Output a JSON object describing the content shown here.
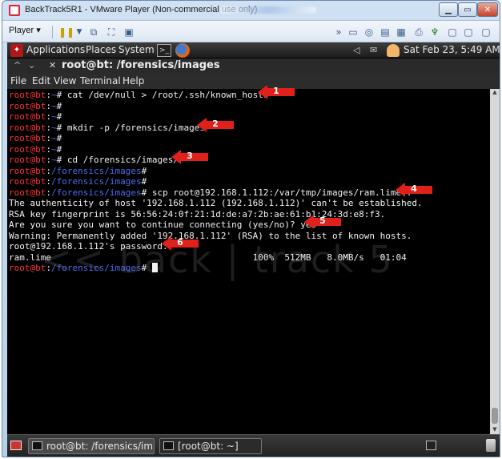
{
  "vm": {
    "title": "BackTrack5R1 - VMware Player (Non-commercial use only)",
    "player_label": "Player ▾",
    "minimize": "▁",
    "maximize": "▭",
    "close": "✕"
  },
  "gnome_panel": {
    "applications": "Applications",
    "places": "Places",
    "system": "System",
    "datetime": "Sat Feb 23,  5:49 AM"
  },
  "terminal": {
    "title": "root@bt: /forensics/images",
    "menu": [
      "File",
      "Edit",
      "View",
      "Terminal",
      "Help"
    ],
    "watermark": "<< back | track 5",
    "lines": [
      {
        "user": "root@bt",
        "path": "~",
        "cmd": "cat /dev/null > /root/.ssh/known_hosts"
      },
      {
        "user": "root@bt",
        "path": "~",
        "cmd": ""
      },
      {
        "user": "root@bt",
        "path": "~",
        "cmd": ""
      },
      {
        "user": "root@bt",
        "path": "~",
        "cmd": "mkdir -p /forensics/images"
      },
      {
        "user": "root@bt",
        "path": "~",
        "cmd": ""
      },
      {
        "user": "root@bt",
        "path": "~",
        "cmd": ""
      },
      {
        "user": "root@bt",
        "path": "~",
        "cmd": "cd /forensics/images/"
      },
      {
        "user": "root@bt",
        "path": "/forensics/images",
        "cmd": ""
      },
      {
        "user": "root@bt",
        "path": "/forensics/images",
        "cmd": ""
      },
      {
        "user": "root@bt",
        "path": "/forensics/images",
        "cmd": "scp root@192.168.1.112:/var/tmp/images/ram.lime ."
      },
      {
        "text": "The authenticity of host '192.168.1.112 (192.168.1.112)' can't be established."
      },
      {
        "text": "RSA key fingerprint is 56:56:24:0f:21:1d:de:a7:2b:ae:61:b1:24:3d:e8:f3."
      },
      {
        "text": "Are you sure you want to continue connecting (yes/no)? yes"
      },
      {
        "text": "Warning: Permanently added '192.168.1.112' (RSA) to the list of known hosts."
      },
      {
        "text": "root@192.168.1.112's password:"
      },
      {
        "text": "ram.lime                                      100%  512MB   8.0MB/s   01:04"
      },
      {
        "user": "root@bt",
        "path": "/forensics/images",
        "cmd": "",
        "cursor": true
      }
    ]
  },
  "annotations": [
    "1",
    "2",
    "3",
    "4",
    "5",
    "6"
  ],
  "taskbar": {
    "task1": "root@bt: /forensics/im...",
    "task2": "[root@bt: ~]"
  },
  "colors": {
    "prompt_user": "#ff3333",
    "prompt_path": "#4d6cf0",
    "arrow": "#e0201a"
  }
}
